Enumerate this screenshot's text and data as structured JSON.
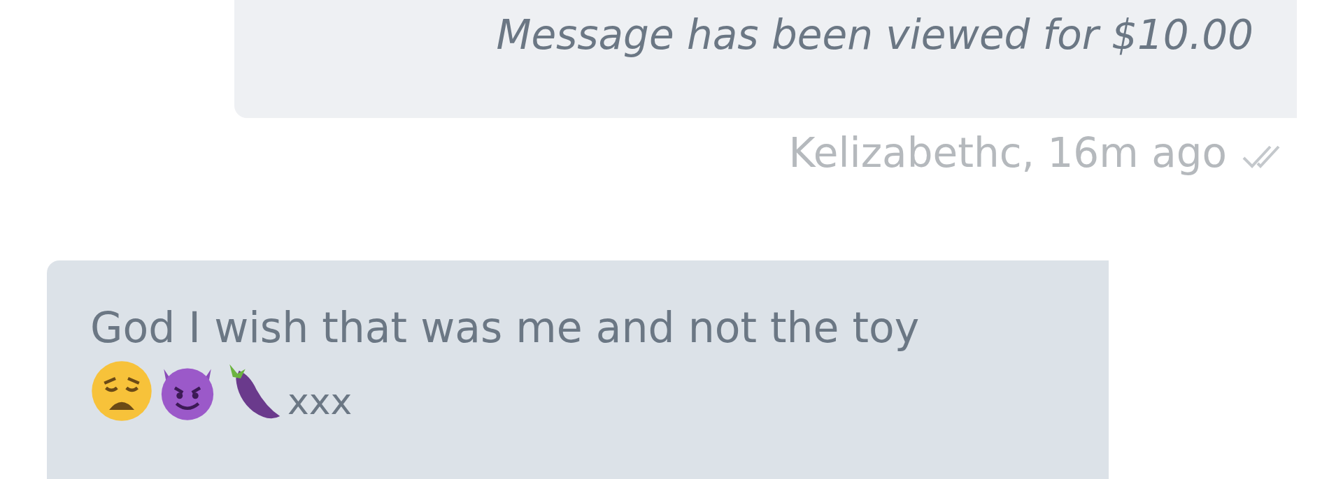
{
  "messages": [
    {
      "kind": "paid_notice",
      "text": "Message has been viewed for $10.00",
      "meta": "Kelizabethc, 16m ago",
      "read": true
    },
    {
      "kind": "received",
      "text": "God I wish that was me and not the toy",
      "tail": "xxx"
    }
  ]
}
